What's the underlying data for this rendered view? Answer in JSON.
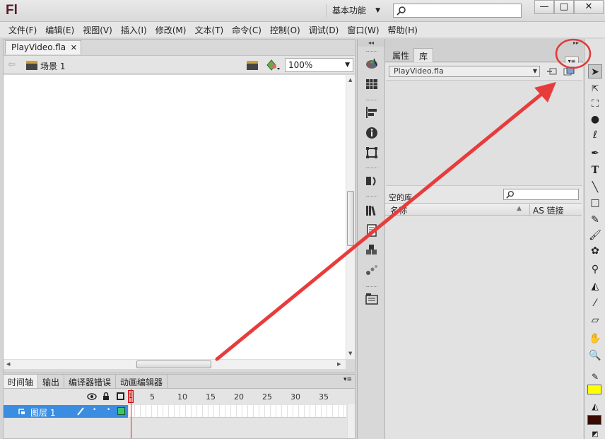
{
  "app": {
    "logo": "Fl",
    "workspace": "基本功能",
    "window_buttons": [
      "—",
      "□",
      "✕"
    ]
  },
  "menu": [
    "文件(F)",
    "编辑(E)",
    "视图(V)",
    "插入(I)",
    "修改(M)",
    "文本(T)",
    "命令(C)",
    "控制(O)",
    "调试(D)",
    "窗口(W)",
    "帮助(H)"
  ],
  "document": {
    "tab": "PlayVideo.fla",
    "scene": "场景 1",
    "zoom": "100%"
  },
  "timeline": {
    "tabs": [
      "时间轴",
      "输出",
      "编译器错误",
      "动画编辑器"
    ],
    "frame_numbers": [
      "1",
      "5",
      "10",
      "15",
      "20",
      "25",
      "30",
      "35"
    ],
    "layer_name": "图层 1"
  },
  "panel": {
    "tabs": [
      "属性",
      "库"
    ],
    "active_tab": "库",
    "library_select": "PlayVideo.fla",
    "empty_label": "空的库",
    "columns": {
      "name": "名称",
      "linkage": "AS 链接"
    }
  },
  "tools": {
    "stroke_color": "#3a0a00",
    "fill_color": "#ffff00"
  },
  "annotation": {
    "circle_color": "#e23a3a",
    "arrow_color": "#e83c3c"
  }
}
